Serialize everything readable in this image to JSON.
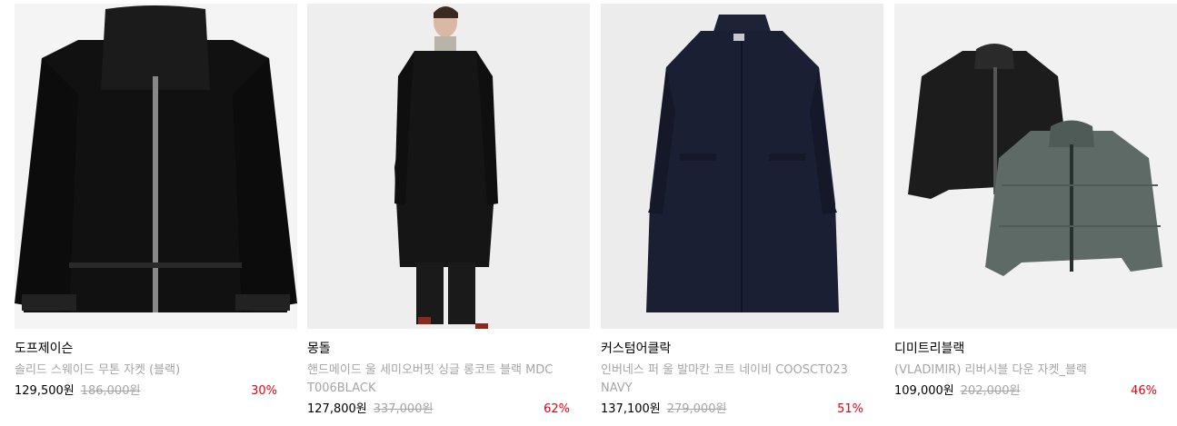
{
  "products": [
    {
      "brand": "도프제이슨",
      "name": "솔리드 스웨이드 무톤 자켓 (블랙)",
      "price": "129,500원",
      "original_price": "186,000원",
      "discount": "30%",
      "image_icon": "black-shearling-jacket-image"
    },
    {
      "brand": "몽돌",
      "name": "핸드메이드 울 세미오버핏 싱글 롱코트 블랙 MDCT006BLACK",
      "price": "127,800원",
      "original_price": "337,000원",
      "discount": "62%",
      "image_icon": "model-black-long-coat-image"
    },
    {
      "brand": "커스텀어클락",
      "name": "인버네스 퍼 울 발마칸 코트 네이비 COOSCT023NAVY",
      "price": "137,100원",
      "original_price": "279,000원",
      "discount": "51%",
      "image_icon": "navy-balmacaan-coat-image"
    },
    {
      "brand": "디미트리블랙",
      "name": "(VLADIMIR) 리버시블 다운 자켓_블랙",
      "price": "109,000원",
      "original_price": "202,000원",
      "discount": "46%",
      "image_icon": "reversible-down-jacket-image"
    }
  ],
  "colors": {
    "discount": "#e60012",
    "muted_text": "#a5a5a5",
    "thumb_bg": "#efefef"
  }
}
